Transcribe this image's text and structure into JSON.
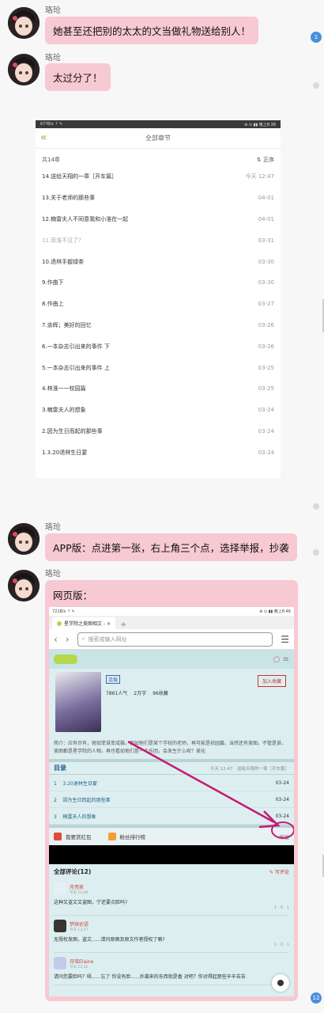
{
  "chat": {
    "sender": "珞玱",
    "messages": [
      {
        "text": "她甚至还把别的太太的文当做礼物送给别人！"
      },
      {
        "text": "太过分了！"
      },
      {
        "text": "APP版：点进第一张，右上角三个点，选择举报，抄袭"
      },
      {
        "text": "网页版："
      }
    ],
    "badges": [
      "1",
      "12"
    ]
  },
  "app_shot": {
    "status_left": "67?B/s ⇡ ✎",
    "status_right": "⊕ ⊙ ▮▮ 晚上8:38",
    "nav_title": "全部章节",
    "count_label": "共14章",
    "sort_label": "正序",
    "chapters": [
      {
        "title": "14.送给天翔的一章［开车篇］",
        "date": "今天 12:47"
      },
      {
        "title": "13.关于老师的那些事",
        "date": "04-01"
      },
      {
        "title": "12.楠雷夫人不同意我和小淮在一起",
        "date": "04-01"
      },
      {
        "title": "11.菲淮不见了?",
        "date": "03-31"
      },
      {
        "title": "10.退林手握绿茶",
        "date": "03-30"
      },
      {
        "title": "9.作曲下",
        "date": "03-30"
      },
      {
        "title": "8.作曲上",
        "date": "03-27"
      },
      {
        "title": "7.余辉；美好的回忆",
        "date": "03-26"
      },
      {
        "title": "6.一本杂志引出来的事件 下",
        "date": "03-26"
      },
      {
        "title": "5.一本杂志引出来的事件 上",
        "date": "03-25"
      },
      {
        "title": "4.林淮一一校园篇",
        "date": "03-25"
      },
      {
        "title": "3.楠雷夫人的想象",
        "date": "03-24"
      },
      {
        "title": "2.因为生日而起的那些事",
        "date": "03-24"
      },
      {
        "title": "1.3.20退林生日宴",
        "date": "03-24"
      }
    ]
  },
  "web_shot": {
    "status_left": "721B/s ⇡ ✎",
    "status_right": "⊕ ⊙ ▮▮ 晚上8:46",
    "tab_title": "星学院之美图相文 - ×",
    "url_placeholder": "搜索或输入网址",
    "tag": "连载",
    "stats": [
      "7861人气",
      "2万字",
      "96收藏"
    ],
    "collect_label": "加入收藏",
    "description": "简介：应有尽有，假如菲淮变成猫，假如他们是某个学校的老师，再可能是校园篇，当然还有美图。不管是谁，美图都是星学院的人物。再也看如他们是一个乐团，会发生什么呢？美化",
    "toc_title": "目录",
    "toc_latest": "今天 12:47　送给天翔的一章［开车篇］",
    "toc": [
      {
        "num": "1",
        "title": "3.20退林生日宴",
        "date": "03-24"
      },
      {
        "num": "2",
        "title": "因为生日而起的那些事",
        "date": "03-24"
      },
      {
        "num": "3",
        "title": "楠雷夫人的想象",
        "date": "03-24"
      }
    ],
    "action_redpacket": "我要赏红包",
    "action_fans": "粉丝排行榜",
    "action_report": "举报",
    "comments_title": "全部评论(12)",
    "comments_post": "写评论",
    "comments": [
      {
        "name": "月亮家",
        "time": "今天 13:46",
        "text": "这种又盗文又盗图，宁还要点脸吗?",
        "meta": "1 · 0 · 1"
      },
      {
        "name": "梦续初语",
        "time": "今天 13:37",
        "text": "无授权发图，盗文......请问原图及原文作者授权了嘛?",
        "meta": "1 · 0 · 1"
      },
      {
        "name": "月瑶Elaine",
        "time": "今天 13:32",
        "text": "请问您要脸吗？唔......忘了 你没有脸......抄袭来的东西就是香 对吧？你对得起那些辛辛苦苦",
        "meta": ""
      }
    ],
    "colors": {
      "annotation": "#c41b73",
      "bubble": "#f7c9d2"
    }
  }
}
